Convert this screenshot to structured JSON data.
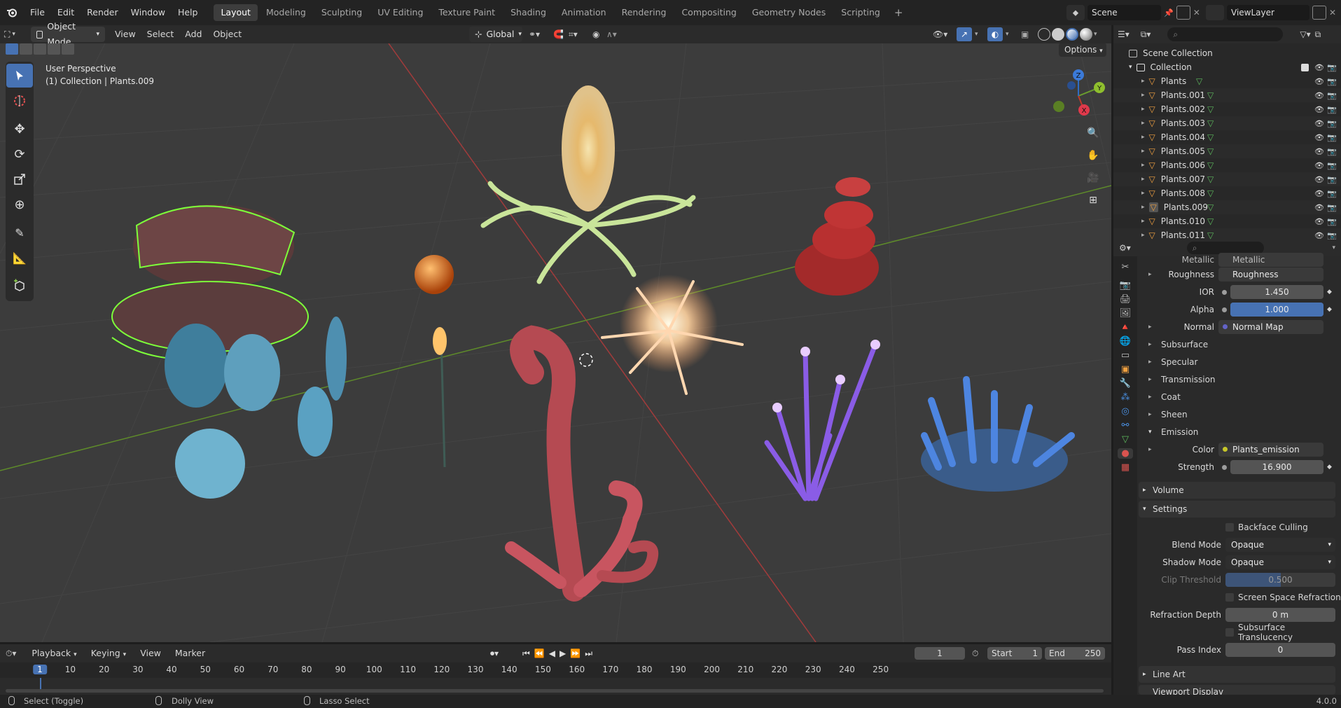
{
  "menus": [
    "File",
    "Edit",
    "Render",
    "Window",
    "Help"
  ],
  "workspaces": [
    "Layout",
    "Modeling",
    "Sculpting",
    "UV Editing",
    "Texture Paint",
    "Shading",
    "Animation",
    "Rendering",
    "Compositing",
    "Geometry Nodes",
    "Scripting"
  ],
  "active_workspace": "Layout",
  "scene": "Scene",
  "view_layer": "ViewLayer",
  "viewport": {
    "mode": "Object Mode",
    "menu": [
      "View",
      "Select",
      "Add",
      "Object"
    ],
    "transform_orientation": "Global",
    "options_label": "Options",
    "perspective_text": "User Perspective",
    "context_text": "(1) Collection | Plants.009"
  },
  "gizmo": {
    "x": "X",
    "y": "Y",
    "z": "Z"
  },
  "outliner": {
    "root": "Scene Collection",
    "collection": "Collection",
    "objects": [
      "Plants",
      "Plants.001",
      "Plants.002",
      "Plants.003",
      "Plants.004",
      "Plants.005",
      "Plants.006",
      "Plants.007",
      "Plants.008",
      "Plants.009",
      "Plants.010",
      "Plants.011"
    ],
    "selected": "Plants.009"
  },
  "properties": {
    "metallic_label": "Metallic",
    "metallic_value": "Metallic",
    "roughness_label": "Roughness",
    "roughness_value": "Roughness",
    "ior_label": "IOR",
    "ior_value": "1.450",
    "alpha_label": "Alpha",
    "alpha_value": "1.000",
    "alpha_fill": 1.0,
    "normal_label": "Normal",
    "normal_value": "Normal Map",
    "sections": [
      "Subsurface",
      "Specular",
      "Transmission",
      "Coat",
      "Sheen"
    ],
    "emission_label": "Emission",
    "color_label": "Color",
    "color_value": "Plants_emission",
    "strength_label": "Strength",
    "strength_value": "16.900",
    "volume_label": "Volume",
    "settings_label": "Settings",
    "backface_label": "Backface Culling",
    "blend_label": "Blend Mode",
    "blend_value": "Opaque",
    "shadow_label": "Shadow Mode",
    "shadow_value": "Opaque",
    "clip_label": "Clip Threshold",
    "clip_value": "0.500",
    "clip_fill": 0.5,
    "ssr_label": "Screen Space Refraction",
    "refr_label": "Refraction Depth",
    "refr_value": "0 m",
    "sst_label": "Subsurface Translucency",
    "pass_label": "Pass Index",
    "pass_value": "0",
    "lineart_label": "Line Art",
    "viewport_display_label": "Viewport Display"
  },
  "timeline": {
    "menu": [
      "Playback",
      "Keying",
      "View",
      "Marker"
    ],
    "current_frame": "1",
    "start_label": "Start",
    "start_value": "1",
    "end_label": "End",
    "end_value": "250",
    "ticks": [
      "1",
      "10",
      "20",
      "30",
      "40",
      "50",
      "60",
      "70",
      "80",
      "90",
      "100",
      "110",
      "120",
      "130",
      "140",
      "150",
      "160",
      "170",
      "180",
      "190",
      "200",
      "210",
      "220",
      "230",
      "240",
      "250"
    ]
  },
  "status": {
    "select": "Select (Toggle)",
    "dolly": "Dolly View",
    "lasso": "Lasso Select",
    "version": "4.0.0"
  },
  "colors": {
    "accent": "#4772b3",
    "x_axis": "#c0392b",
    "y_axis": "#6b9d2e",
    "z_axis": "#2f6cc4"
  }
}
